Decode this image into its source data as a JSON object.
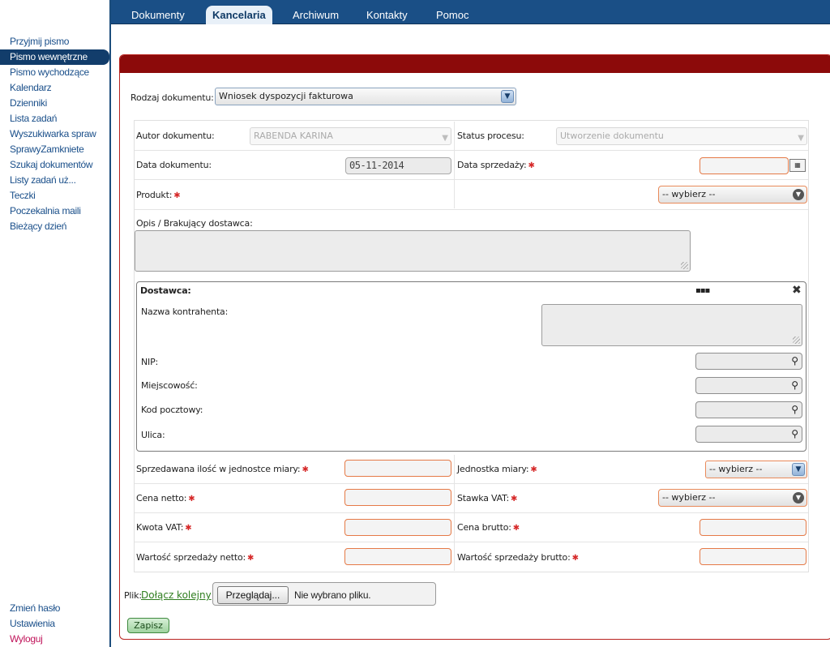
{
  "sidebar": {
    "items": [
      {
        "label": "Przyjmij pismo"
      },
      {
        "label": "Pismo wewnętrzne"
      },
      {
        "label": "Pismo wychodzące"
      },
      {
        "label": "Kalendarz"
      },
      {
        "label": "Dzienniki"
      },
      {
        "label": "Lista zadań"
      },
      {
        "label": "Wyszukiwarka spraw"
      },
      {
        "label": "SprawyZamkniete"
      },
      {
        "label": "Szukaj dokumentów"
      },
      {
        "label": "Listy zadań uż..."
      },
      {
        "label": "Teczki"
      },
      {
        "label": "Poczekalnia maili"
      },
      {
        "label": "Bieżący dzień"
      }
    ],
    "active_index": 1,
    "bottom": {
      "change_password": "Zmień hasło",
      "settings": "Ustawienia",
      "logout": "Wyloguj"
    }
  },
  "nav": {
    "tabs": [
      {
        "label": "Dokumenty"
      },
      {
        "label": "Kancelaria"
      },
      {
        "label": "Archiwum"
      },
      {
        "label": "Kontakty"
      },
      {
        "label": "Pomoc"
      }
    ],
    "active_index": 1
  },
  "form": {
    "doc_type_label": "Rodzaj dokumentu:",
    "doc_type_value": "Wniosek dyspozycji fakturowa",
    "author_label": "Autor dokumentu:",
    "author_value": "RABENDA KARINA",
    "status_label": "Status procesu:",
    "status_value": "Utworzenie dokumentu",
    "doc_date_label": "Data dokumentu:",
    "doc_date_value": "05-11-2014",
    "sale_date_label": "Data sprzedaży:",
    "product_label": "Produkt:",
    "product_value": "-- wybierz --",
    "description_label": "Opis / Brakujący dostawca:",
    "supplier": {
      "title": "Dostawca:",
      "name_label": "Nazwa kontrahenta:",
      "nip_label": "NIP:",
      "city_label": "Miejscowość:",
      "postcode_label": "Kod pocztowy:",
      "street_label": "Ulica:"
    },
    "qty_label": "Sprzedawana ilość w jednostce miary:",
    "unit_label": "Jednostka miary:",
    "unit_value": "-- wybierz --",
    "net_price_label": "Cena netto:",
    "vat_rate_label": "Stawka VAT:",
    "vat_rate_value": "-- wybierz --",
    "vat_amount_label": "Kwota VAT:",
    "gross_price_label": "Cena brutto:",
    "net_sale_label": "Wartość sprzedaży netto:",
    "gross_sale_label": "Wartość sprzedaży brutto:",
    "file_label": "Plik:",
    "attach_link": "Dołącz kolejny",
    "browse_label": "Przeglądaj...",
    "no_file": "Nie wybrano pliku.",
    "save_label": "Zapisz",
    "required_mark": "✱"
  },
  "colors": {
    "nav_bg": "#1a4f86",
    "frame_header": "#8c0a0a",
    "required": "#d62a2a",
    "link": "#2e7d1e"
  }
}
